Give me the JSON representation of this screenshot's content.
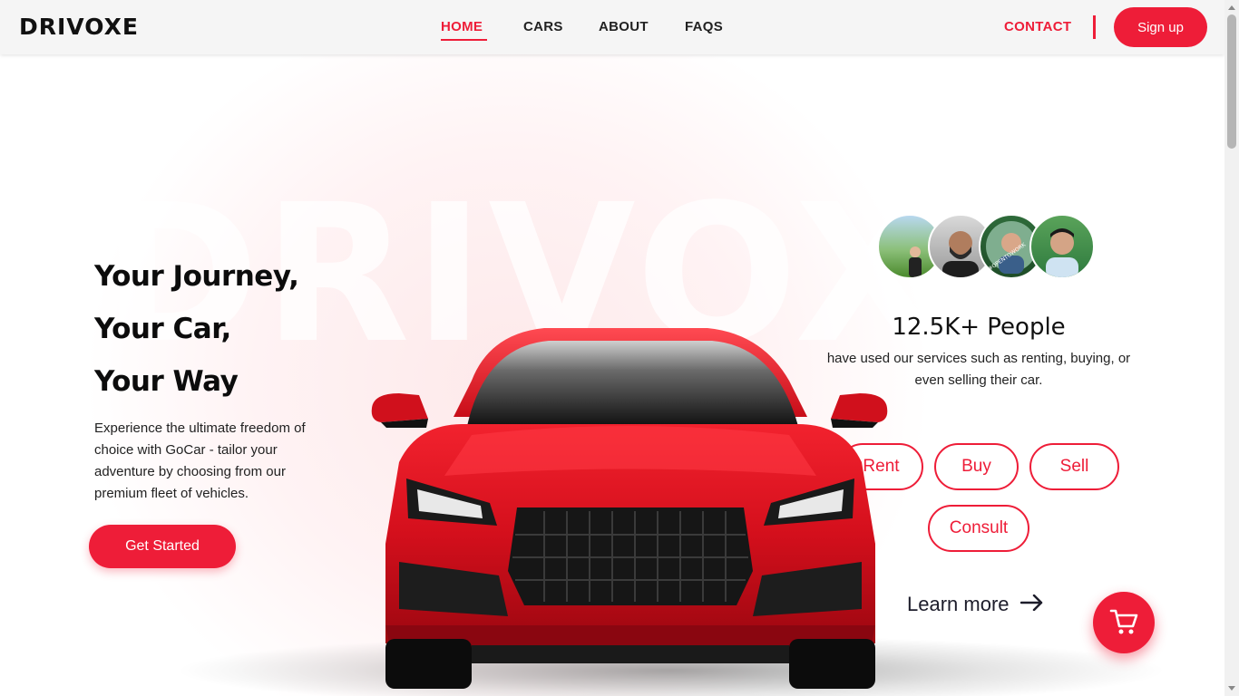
{
  "brand": {
    "logo": "DRIVOXE",
    "watermark": "DRIVOXE",
    "accent": "#ee1d38"
  },
  "nav": {
    "items": [
      {
        "label": "HOME",
        "active": true
      },
      {
        "label": "CARS",
        "active": false
      },
      {
        "label": "ABOUT",
        "active": false
      },
      {
        "label": "FAQS",
        "active": false
      }
    ],
    "contact": "CONTACT",
    "signup": "Sign up"
  },
  "hero": {
    "lines": [
      "Your Journey,",
      "Your Car,",
      "Your Way"
    ],
    "description": "Experience the ultimate freedom of choice with GoCar - tailor your adventure by choosing from our premium fleet of vehicles.",
    "cta": "Get Started"
  },
  "stats": {
    "number": "12.5K+ People",
    "text": "have used our services such as renting, buying, or even selling their car.",
    "avatar_icons": [
      "user-avatar-1",
      "user-avatar-2",
      "user-avatar-3",
      "user-avatar-4"
    ],
    "avatar_badge": "#OPENTOWORK"
  },
  "services": [
    "Rent",
    "Buy",
    "Sell",
    "Consult"
  ],
  "learn_more": "Learn more",
  "icons": {
    "learn_more": "arrow-right-icon",
    "cart": "cart-icon"
  }
}
